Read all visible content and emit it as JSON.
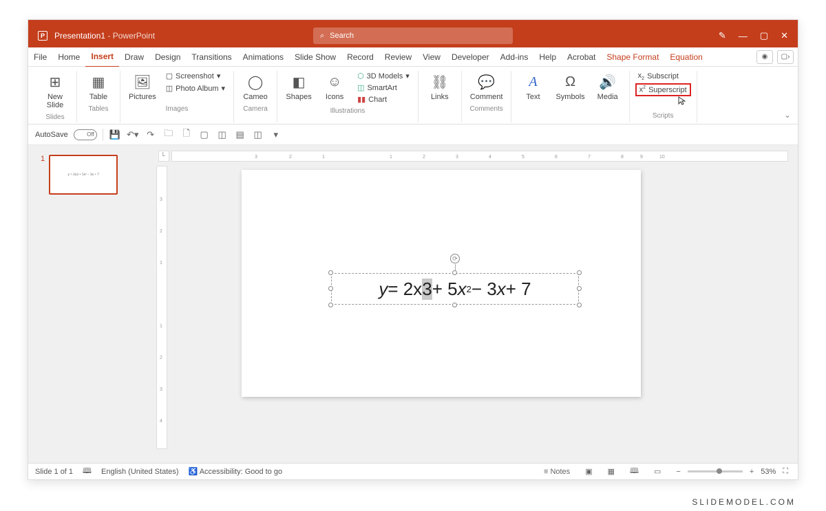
{
  "titlebar": {
    "doc": "Presentation1",
    "app": " - PowerPoint",
    "search_placeholder": "Search"
  },
  "tabs": {
    "file": "File",
    "home": "Home",
    "insert": "Insert",
    "draw": "Draw",
    "design": "Design",
    "transitions": "Transitions",
    "animations": "Animations",
    "slideshow": "Slide Show",
    "record": "Record",
    "review": "Review",
    "view": "View",
    "developer": "Developer",
    "addins": "Add-ins",
    "help": "Help",
    "acrobat": "Acrobat",
    "shapeformat": "Shape Format",
    "equation": "Equation"
  },
  "ribbon": {
    "newslide": "New\nSlide",
    "table": "Table",
    "pictures": "Pictures",
    "screenshot": "Screenshot",
    "photoalbum": "Photo Album",
    "cameo": "Cameo",
    "shapes": "Shapes",
    "icons": "Icons",
    "models": "3D Models",
    "smartart": "SmartArt",
    "chart": "Chart",
    "links": "Links",
    "comment": "Comment",
    "text": "Text",
    "symbols": "Symbols",
    "media": "Media",
    "subscript": "Subscript",
    "superscript": "Superscript",
    "grp_slides": "Slides",
    "grp_tables": "Tables",
    "grp_images": "Images",
    "grp_camera": "Camera",
    "grp_illus": "Illustrations",
    "grp_comments": "Comments",
    "grp_scripts": "Scripts"
  },
  "qat": {
    "autosave": "AutoSave",
    "off": "Off"
  },
  "thumb": {
    "num": "1"
  },
  "equation": {
    "p1": "y",
    "p2": " = 2x",
    "sel": "3",
    "p3": " + 5",
    "p4": "x",
    "sup": "2",
    "p5": " − 3",
    "p6": "x",
    "p7": " + 7"
  },
  "status": {
    "slide": "Slide 1 of 1",
    "lang": "English (United States)",
    "access": "Accessibility: Good to go",
    "notes": "Notes",
    "zoom": "53%"
  },
  "watermark": "SLIDEMODEL.COM"
}
